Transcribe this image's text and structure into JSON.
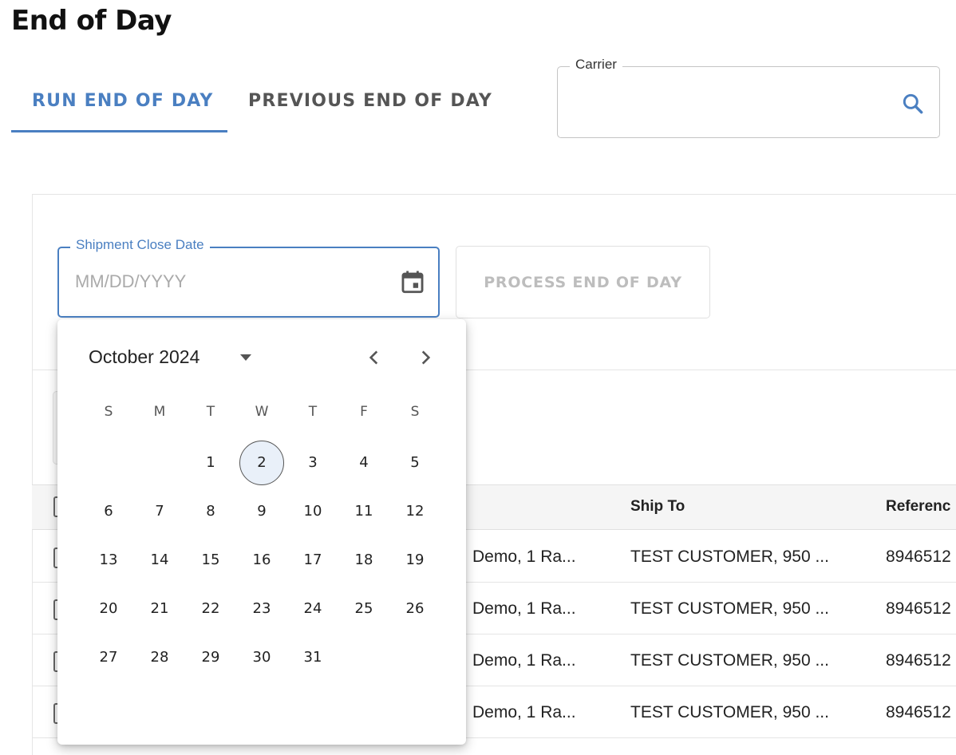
{
  "page": {
    "title": "End of Day"
  },
  "tabs": [
    {
      "label": "RUN END OF DAY",
      "active": true
    },
    {
      "label": "PREVIOUS END OF DAY",
      "active": false
    }
  ],
  "carrier": {
    "label": "Carrier",
    "value": "",
    "icon": "search-icon"
  },
  "form": {
    "date_label": "Shipment Close Date",
    "date_placeholder": "MM/DD/YYYY",
    "date_icon": "calendar-icon",
    "process_label": "PROCESS END OF DAY"
  },
  "table": {
    "columns": [
      "Ship To",
      "Referenc"
    ],
    "rows": [
      {
        "ship_from": "Demo, 1 Ra...",
        "ship_to": "TEST CUSTOMER, 950 ...",
        "reference": "8946512"
      },
      {
        "ship_from": "Demo, 1 Ra...",
        "ship_to": "TEST CUSTOMER, 950 ...",
        "reference": "8946512"
      },
      {
        "ship_from": "Demo, 1 Ra...",
        "ship_to": "TEST CUSTOMER, 950 ...",
        "reference": "8946512"
      },
      {
        "ship_from": "Demo, 1 Ra...",
        "ship_to": "TEST CUSTOMER, 950 ...",
        "reference": "8946512"
      }
    ]
  },
  "calendar": {
    "month_label": "October 2024",
    "weekdays": [
      "S",
      "M",
      "T",
      "W",
      "T",
      "F",
      "S"
    ],
    "first_weekday_index": 2,
    "days_in_month": 31,
    "today": 2
  },
  "colors": {
    "accent": "#4a7fc1",
    "disabled_text": "#bdbdbd",
    "today_fill": "#e9f0f9"
  }
}
